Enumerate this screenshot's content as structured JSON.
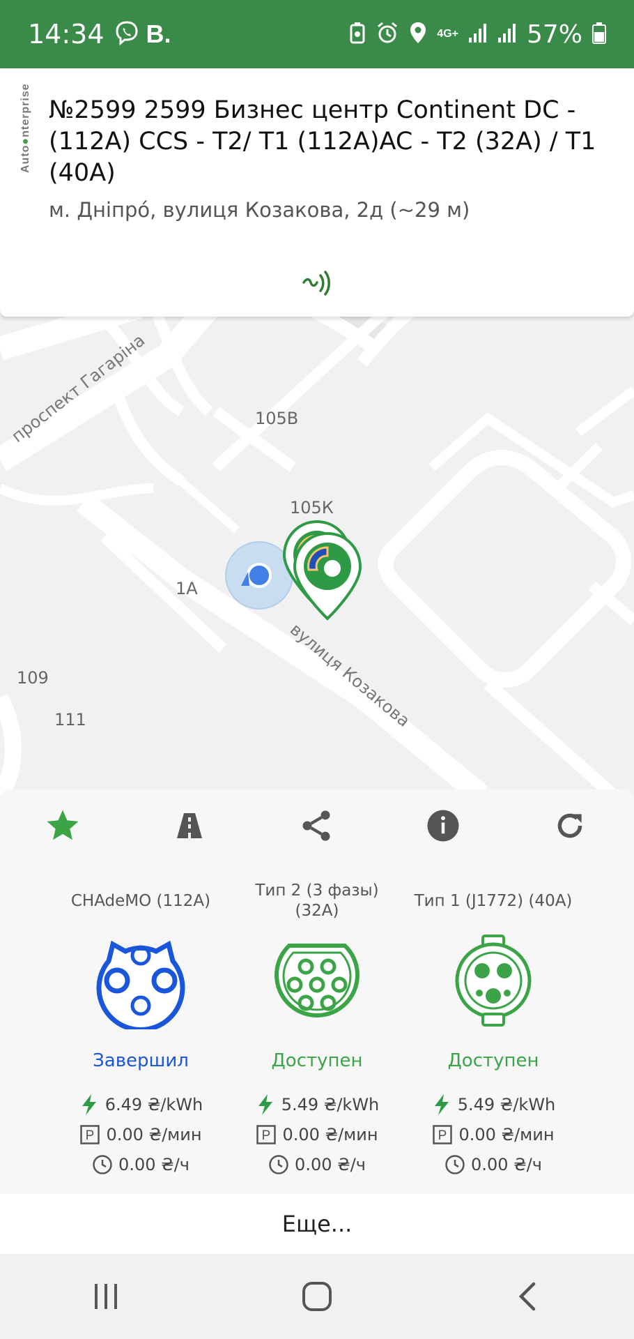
{
  "status_bar": {
    "time": "14:34",
    "viber_letter": "B.",
    "network": "4G+",
    "battery": "57%"
  },
  "station": {
    "brand": [
      "Auto",
      "nterprise"
    ],
    "title": "№2599 2599 Бизнес центр Continent DC - (112A) CCS - T2/ T1 (112A)AC - T2 (32A) / T1 (40A)",
    "address": "м. Дніпро́, вулиця Козакова, 2д (~29 м)"
  },
  "map": {
    "labels": [
      "105В",
      "105К",
      "1А",
      "109",
      "111"
    ],
    "roads": [
      "проспект Гагаріна",
      "вулиця Козакова"
    ]
  },
  "actions": [
    "star-icon",
    "road-icon",
    "share-icon",
    "info-icon",
    "refresh-icon"
  ],
  "connectors": [
    {
      "name": "CHAdeMO (112A)",
      "status": "Завершил",
      "status_color": "#1a56db",
      "energy_price": "6.49 ₴/kWh",
      "parking_price": "0.00 ₴/мин",
      "time_price": "0.00 ₴/ч"
    },
    {
      "name": "Тип 2 (3 фазы) (32A)",
      "status": "Доступен",
      "status_color": "#3aa447",
      "energy_price": "5.49 ₴/kWh",
      "parking_price": "0.00 ₴/мин",
      "time_price": "0.00 ₴/ч"
    },
    {
      "name": "Тип 1 (J1772) (40A)",
      "status": "Доступен",
      "status_color": "#3aa447",
      "energy_price": "5.49 ₴/kWh",
      "parking_price": "0.00 ₴/мин",
      "time_price": "0.00 ₴/ч"
    }
  ],
  "more_label": "Еще...",
  "colors": {
    "status_bar": "#3a8a4a",
    "accent_green": "#3aa447",
    "accent_blue": "#1a56db"
  }
}
